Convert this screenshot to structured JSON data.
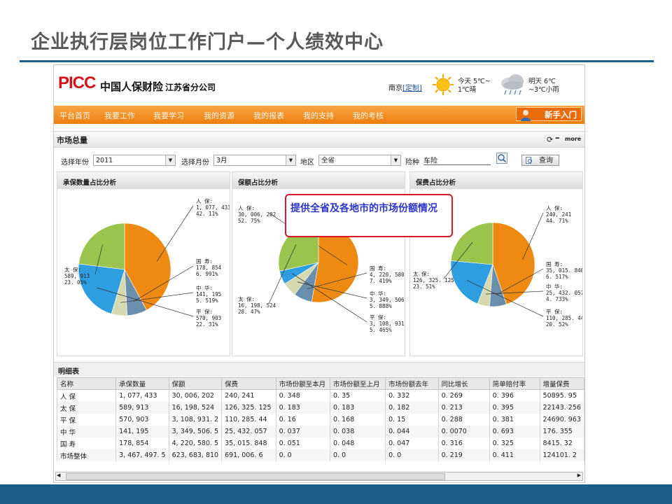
{
  "slide": {
    "title": "企业执行层岗位工作门户—个人绩效中心"
  },
  "header": {
    "logo": "PICC",
    "company": "中国人保财险",
    "branch": "江苏省分公司",
    "city": "南京",
    "customize": "[定制]",
    "today_line1": "今天 5℃~",
    "today_line2": "1℃晴",
    "tomorrow_line1": "明天 6℃",
    "tomorrow_line2": "~3℃小雨"
  },
  "nav": {
    "items": [
      "平台首页",
      "我要工作",
      "我要学习",
      "我的资源",
      "我的报表",
      "我的支持",
      "我的考核"
    ],
    "newbie": "新手入门"
  },
  "market": {
    "title": "市场总量",
    "more": "more"
  },
  "filters": {
    "year_label": "选择年份",
    "year_value": "2011",
    "month_label": "选择月份",
    "month_value": "3月",
    "region_label": "地区",
    "region_value": "全省",
    "type_label": "险种",
    "type_value": "车险",
    "query_label": "查询"
  },
  "panels": [
    {
      "title": "承保数量占比分析"
    },
    {
      "title": "保额占比分析"
    },
    {
      "title": "保费占比分析"
    }
  ],
  "callout": "提供全省及各地市的市场份额情况",
  "charts": {
    "colors": {
      "人保": "#ee8a12",
      "太保": "#9ac44e",
      "平保": "#2e9ee0",
      "中华": "#d6d9b0",
      "国寿": "#6a8fac"
    },
    "panel1": [
      {
        "name": "人 保:",
        "value": "1, 077, 433",
        "pct": "42. 11%"
      },
      {
        "name": "国 寿:",
        "value": "178, 854",
        "pct": "6. 991%"
      },
      {
        "name": "中 华:",
        "value": "141, 195",
        "pct": "5. 519%"
      },
      {
        "name": "平 保:",
        "value": "570, 903",
        "pct": "22. 31%"
      },
      {
        "name": "太 保:",
        "value": "589, 913",
        "pct": "23. 05%"
      }
    ],
    "panel2": [
      {
        "name": "人 保:",
        "value": "30, 006, 202",
        "pct": "52. 75%"
      },
      {
        "name": "国 寿:",
        "value": "4, 220, 580. 5",
        "pct": "7. 419%"
      },
      {
        "name": "中 华:",
        "value": "3, 349, 506. 5",
        "pct": "5. 888%"
      },
      {
        "name": "平 保:",
        "value": "3, 108, 931. 2",
        "pct": "5. 465%"
      },
      {
        "name": "太 保:",
        "value": "16, 198, 524",
        "pct": "28. 47%"
      }
    ],
    "panel3": [
      {
        "name": "人 保:",
        "value": "240, 241",
        "pct": "44. 71%"
      },
      {
        "name": "国 寿:",
        "value": "35, 015. 848",
        "pct": "6. 517%"
      },
      {
        "name": "中 华:",
        "value": "25, 432. 057",
        "pct": "4. 733%"
      },
      {
        "name": "平 保:",
        "value": "110, 285. 44",
        "pct": "20. 52%"
      },
      {
        "name": "太 保:",
        "value": "126, 325. 125",
        "pct": "23. 51%"
      }
    ]
  },
  "chart_data": [
    {
      "type": "pie",
      "title": "承保数量占比分析",
      "categories": [
        "人保",
        "国寿",
        "中华",
        "平保",
        "太保"
      ],
      "values": [
        42.11,
        6.991,
        5.519,
        22.31,
        23.05
      ]
    },
    {
      "type": "pie",
      "title": "保额占比分析",
      "categories": [
        "人保",
        "国寿",
        "中华",
        "平保",
        "太保"
      ],
      "values": [
        52.75,
        7.419,
        5.888,
        5.465,
        28.47
      ]
    },
    {
      "type": "pie",
      "title": "保费占比分析",
      "categories": [
        "人保",
        "国寿",
        "中华",
        "平保",
        "太保"
      ],
      "values": [
        44.71,
        6.517,
        4.733,
        20.52,
        23.51
      ]
    }
  ],
  "detail": {
    "title": "明细表",
    "columns": [
      "名称",
      "承保数量",
      "保额",
      "保费",
      "市场份额至本月",
      "市场份额至上月",
      "市场份额去年",
      "同比增长",
      "简单赔付率",
      "增量保费"
    ],
    "rows": [
      [
        "人 保",
        "1, 077, 433",
        "30, 006, 202",
        "240, 241",
        "0. 348",
        "0. 35",
        "0. 332",
        "0. 269",
        "0. 396",
        "50895. 95"
      ],
      [
        "太 保",
        "589, 913",
        "16, 198, 524",
        "126, 325. 125",
        "0. 183",
        "0. 183",
        "0. 182",
        "0. 213",
        "0. 395",
        "22143. 256"
      ],
      [
        "平 保",
        "570, 903",
        "3, 108, 931. 2",
        "110, 285. 44",
        "0. 16",
        "0. 168",
        "0. 15",
        "0. 288",
        "0. 381",
        "24690. 963"
      ],
      [
        "中 华",
        "141, 195",
        "3, 349, 506. 5",
        "25, 432. 057",
        "0. 037",
        "0. 038",
        "0. 044",
        "0. 0070",
        "0. 693",
        "176. 355"
      ],
      [
        "国 寿",
        "178, 854",
        "4, 220, 580. 5",
        "35, 015. 848",
        "0. 051",
        "0. 048",
        "0. 047",
        "0. 316",
        "0. 325",
        "8415. 32"
      ],
      [
        "市场整体",
        "3, 467, 497. 5",
        "623, 683, 810",
        "691, 006. 6",
        "0. 0",
        "0. 0",
        "0. 0",
        "0. 219",
        "0. 411",
        "124101. 2"
      ]
    ]
  }
}
